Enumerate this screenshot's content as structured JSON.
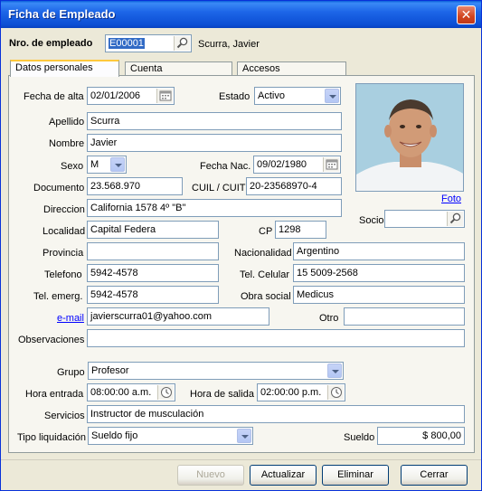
{
  "window": {
    "title": "Ficha de Empleado",
    "close_label": "✕"
  },
  "header": {
    "employee_no_label": "Nro. de empleado",
    "employee_no_value": "E00001",
    "employee_name": "Scurra, Javier"
  },
  "tabs": [
    {
      "label": "Datos personales",
      "active": true
    },
    {
      "label": "Cuenta",
      "active": false
    },
    {
      "label": "Accesos",
      "active": false
    }
  ],
  "form": {
    "fecha_alta": {
      "label": "Fecha de alta",
      "value": "02/01/2006"
    },
    "estado": {
      "label": "Estado",
      "value": "Activo"
    },
    "apellido": {
      "label": "Apellido",
      "value": "Scurra"
    },
    "nombre": {
      "label": "Nombre",
      "value": "Javier"
    },
    "sexo": {
      "label": "Sexo",
      "value": "M"
    },
    "fecha_nac": {
      "label": "Fecha Nac.",
      "value": "09/02/1980"
    },
    "documento": {
      "label": "Documento",
      "value": "23.568.970"
    },
    "cuil": {
      "label": "CUIL / CUIT",
      "value": "20-23568970-4"
    },
    "direccion": {
      "label": "Direccion",
      "value": "California 1578 4º \"B\""
    },
    "localidad": {
      "label": "Localidad",
      "value": "Capital Federa"
    },
    "cp": {
      "label": "CP",
      "value": "1298"
    },
    "provincia": {
      "label": "Provincia",
      "value": ""
    },
    "nacionalidad": {
      "label": "Nacionalidad",
      "value": "Argentino"
    },
    "telefono": {
      "label": "Telefono",
      "value": "5942-4578"
    },
    "tel_celular": {
      "label": "Tel. Celular",
      "value": "15 5009-2568"
    },
    "tel_emerg": {
      "label": "Tel. emerg.",
      "value": "5942-4578"
    },
    "obra_social": {
      "label": "Obra social",
      "value": "Medicus"
    },
    "email": {
      "label": "e-mail",
      "value": "javierscurra01@yahoo.com"
    },
    "otro": {
      "label": "Otro",
      "value": ""
    },
    "observaciones": {
      "label": "Observaciones",
      "value": ""
    },
    "grupo": {
      "label": "Grupo",
      "value": "Profesor"
    },
    "hora_entrada": {
      "label": "Hora entrada",
      "value": "08:00:00 a.m."
    },
    "hora_salida": {
      "label": "Hora de salida",
      "value": "02:00:00 p.m."
    },
    "servicios": {
      "label": "Servicios",
      "value": "Instructor de musculación"
    },
    "tipo_liquidacion": {
      "label": "Tipo liquidación",
      "value": "Sueldo fijo"
    },
    "sueldo": {
      "label": "Sueldo",
      "value": "$ 800,00"
    }
  },
  "photo": {
    "link_label": "Foto"
  },
  "socio": {
    "label": "Socio",
    "value": ""
  },
  "buttons": {
    "nuevo": "Nuevo",
    "actualizar": "Actualizar",
    "eliminar": "Eliminar",
    "cerrar": "Cerrar"
  },
  "icons": {
    "search": "search-icon",
    "calendar": "calendar-icon",
    "clock": "clock-icon",
    "dropdown": "chevron-down-icon"
  },
  "colors": {
    "titlebar": "#0C4ED4",
    "dialog_bg": "#ECE9D8",
    "field_border": "#7F9DB9",
    "tab_highlight": "#FFC83C",
    "link": "#0000FF"
  }
}
